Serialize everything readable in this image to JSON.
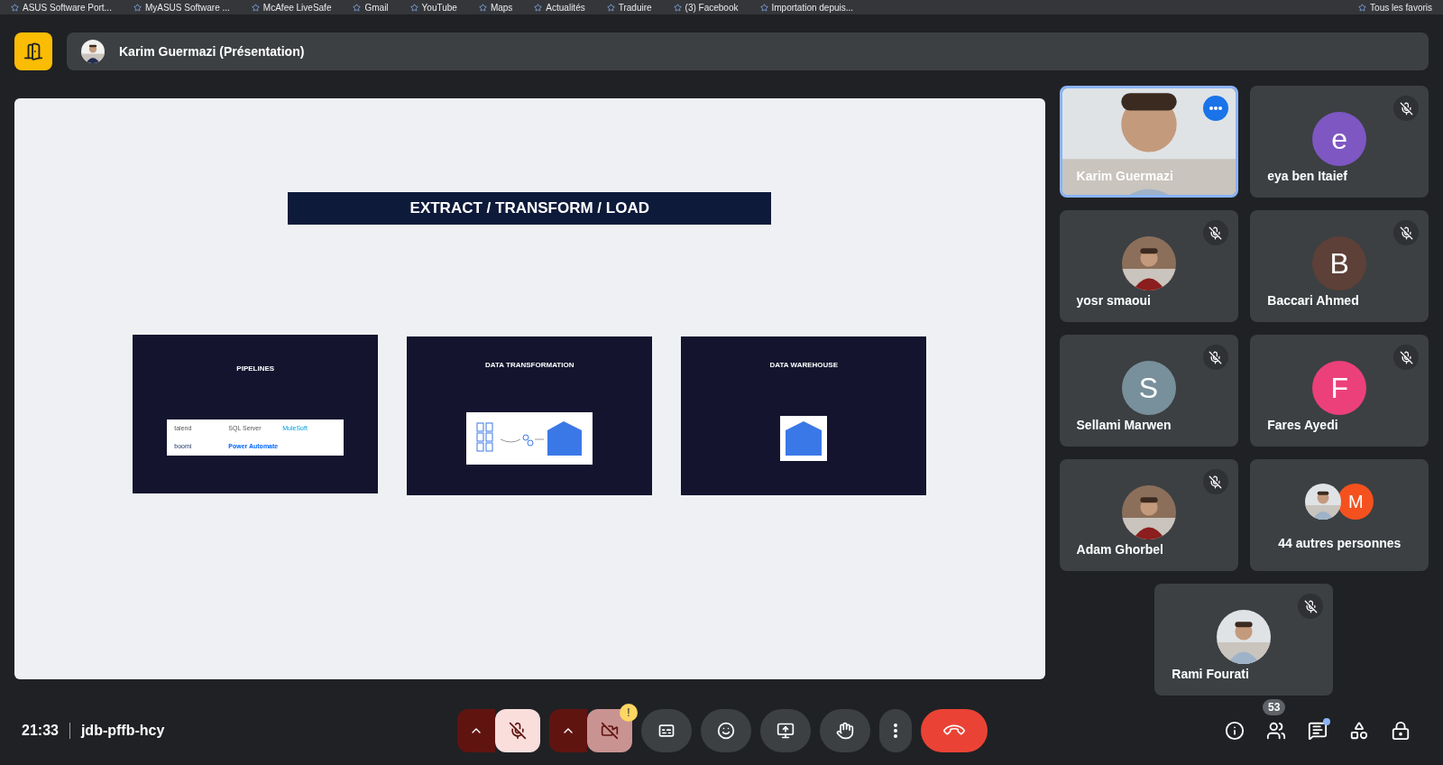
{
  "bookmarks": [
    {
      "label": "ASUS Software Port..."
    },
    {
      "label": "MyASUS Software ..."
    },
    {
      "label": "McAfee LiveSafe"
    },
    {
      "label": "Gmail"
    },
    {
      "label": "YouTube"
    },
    {
      "label": "Maps"
    },
    {
      "label": "Actualités"
    },
    {
      "label": "Traduire"
    },
    {
      "label": "(3) Facebook"
    },
    {
      "label": "Importation depuis..."
    },
    {
      "label": "Tous les favoris"
    }
  ],
  "header": {
    "presenter": "Karim Guermazi (Présentation)"
  },
  "slide": {
    "title": "EXTRACT / TRANSFORM / LOAD",
    "cards": [
      {
        "title": "PIPELINES",
        "kind": "logos",
        "logos": [
          "talend",
          "SQL Server",
          "MuleSoft",
          "boomi",
          "Power Automate"
        ]
      },
      {
        "title": "DATA TRANSFORMATION",
        "kind": "flow"
      },
      {
        "title": "DATA WAREHOUSE",
        "kind": "warehouse"
      }
    ]
  },
  "participants": [
    {
      "name": "Karim Guermazi",
      "kind": "video",
      "speaking": true
    },
    {
      "name": "eya ben Itaief",
      "kind": "letter",
      "letter": "e",
      "color": "#7e57c2",
      "muted": true,
      "speaking": false
    },
    {
      "name": "yosr smaoui",
      "muted": true,
      "speaking": false
    },
    {
      "name": "Baccari Ahmed",
      "kind": "letter",
      "letter": "B",
      "color": "#5d4037",
      "muted": true,
      "speaking": false
    },
    {
      "name": "Sellami Marwen",
      "kind": "letter",
      "letter": "S",
      "color": "#78909c",
      "muted": true,
      "speaking": false
    },
    {
      "name": "Fares Ayedi",
      "kind": "letter",
      "letter": "F",
      "color": "#ec407a",
      "muted": true,
      "speaking": false
    },
    {
      "name": "Adam Ghorbel",
      "muted": true,
      "speaking": false
    },
    {
      "name": "44 autres personnes",
      "kind": "others",
      "letter": "M",
      "color": "#f4511e",
      "speaking": false
    },
    {
      "name": "Rami Fourati",
      "muted": true,
      "speaking": false
    }
  ],
  "bottom": {
    "time": "21:33",
    "meeting_code": "jdb-pffb-hcy",
    "mic_on": false,
    "camera_on": false,
    "camera_warning": "!",
    "people_count": "53",
    "chat_unread": true
  }
}
